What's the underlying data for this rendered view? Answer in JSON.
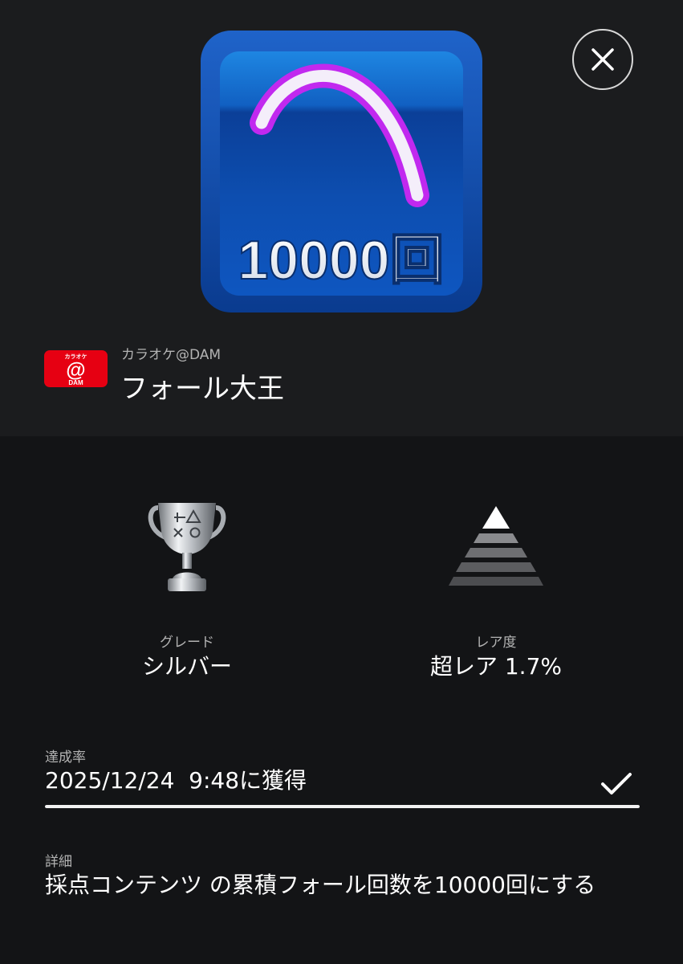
{
  "trophy": {
    "image_text": "10000回",
    "image_icon": "fall-arc-icon",
    "name": "フォール大王"
  },
  "game": {
    "icon_text_top": "カラオケ",
    "icon_text_mid": "@",
    "icon_text_bottom": "DAM",
    "name": "カラオケ@DAM",
    "brand_color": "#e60012"
  },
  "close": {
    "icon": "close-icon"
  },
  "grade": {
    "label": "グレード",
    "value": "シルバー",
    "icon": "silver-trophy-icon"
  },
  "rarity": {
    "label": "レア度",
    "value": "超レア 1.7%",
    "icon": "rarity-pyramid-icon"
  },
  "progress": {
    "label": "達成率",
    "value": "2025/12/24  9:48に獲得",
    "percent": 100,
    "completed_icon": "checkmark-icon"
  },
  "detail": {
    "label": "詳細",
    "value": "採点コンテンツ の累積フォール回数を10000回にする"
  }
}
